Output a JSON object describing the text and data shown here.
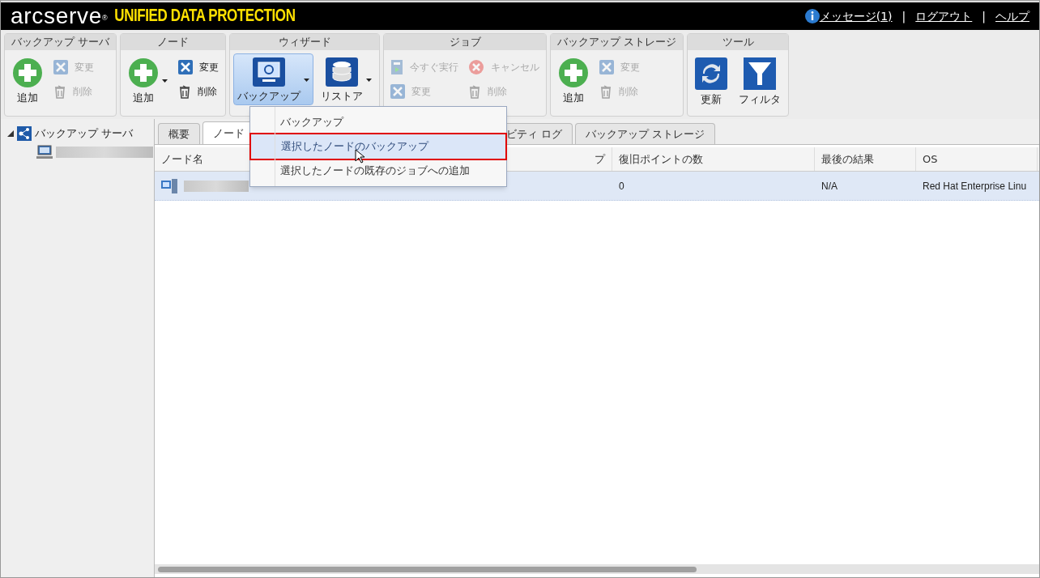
{
  "header": {
    "logo": "arcserve",
    "logo_mark": "®",
    "product": "UNIFIED DATA PROTECTION",
    "links": [
      {
        "label": "メッセージ(1)",
        "kind": "info"
      },
      {
        "label": "ログアウト",
        "kind": "plain"
      },
      {
        "label": "ヘルプ",
        "kind": "plain"
      }
    ],
    "separator": "|"
  },
  "toolbar": {
    "groups": [
      {
        "title": "バックアップ サーバ",
        "items": [
          {
            "kind": "large",
            "label": "追加",
            "disabled": false,
            "dropdown": false,
            "selected": false
          },
          {
            "kind": "small",
            "label": "変更",
            "disabled": true
          },
          {
            "kind": "small",
            "label": "削除",
            "disabled": true
          }
        ]
      },
      {
        "title": "ノード",
        "items": [
          {
            "kind": "large",
            "label": "追加",
            "disabled": false,
            "dropdown": true,
            "selected": false
          },
          {
            "kind": "small",
            "label": "変更",
            "disabled": false
          },
          {
            "kind": "small",
            "label": "削除",
            "disabled": false
          }
        ]
      },
      {
        "title": "ウィザード",
        "items": [
          {
            "kind": "large",
            "label": "バックアップ",
            "disabled": false,
            "dropdown": true,
            "selected": true
          },
          {
            "kind": "large",
            "label": "リストア",
            "disabled": false,
            "dropdown": true,
            "selected": false
          }
        ]
      },
      {
        "title": "ジョブ",
        "items": [
          {
            "kind": "small",
            "label": "今すぐ実行",
            "disabled": true
          },
          {
            "kind": "small",
            "label": "変更",
            "disabled": true
          },
          {
            "kind": "small",
            "label": "キャンセル",
            "disabled": true
          },
          {
            "kind": "small",
            "label": "削除",
            "disabled": true
          }
        ]
      },
      {
        "title": "バックアップ ストレージ",
        "items": [
          {
            "kind": "large",
            "label": "追加",
            "disabled": false,
            "dropdown": false,
            "selected": false
          },
          {
            "kind": "small",
            "label": "変更",
            "disabled": true
          },
          {
            "kind": "small",
            "label": "削除",
            "disabled": true
          }
        ]
      },
      {
        "title": "ツール",
        "items": [
          {
            "kind": "large",
            "label": "更新",
            "disabled": false,
            "dropdown": false,
            "selected": false
          },
          {
            "kind": "large",
            "label": "フィルタ",
            "disabled": false,
            "dropdown": false,
            "selected": false
          }
        ]
      }
    ]
  },
  "sidebar": {
    "tree": [
      {
        "label": "バックアップ サーバ",
        "expanded": true,
        "children": [
          {
            "kind": "redacted"
          }
        ]
      }
    ]
  },
  "tabs": [
    {
      "label": "概要",
      "selected": false
    },
    {
      "label": "ノード",
      "selected": true
    },
    {
      "label": "ビティ ログ",
      "selected": false
    },
    {
      "label": "バックアップ ストレージ",
      "selected": false
    }
  ],
  "table": {
    "columns": [
      {
        "label": "ノード名"
      },
      {
        "label": "プ"
      },
      {
        "label": "復旧ポイントの数"
      },
      {
        "label": "最後の結果"
      },
      {
        "label": "OS"
      }
    ],
    "rows": [
      {
        "selected": true,
        "cells": [
          "",
          "",
          "0",
          "N/A",
          "Red Hat Enterprise Linu"
        ]
      }
    ]
  },
  "menu": {
    "items": [
      {
        "label": "バックアップ",
        "selected": false
      },
      {
        "label": "選択したノードのバックアップ",
        "selected": true
      },
      {
        "label": "選択したノードの既存のジョブへの追加",
        "selected": false
      }
    ]
  }
}
